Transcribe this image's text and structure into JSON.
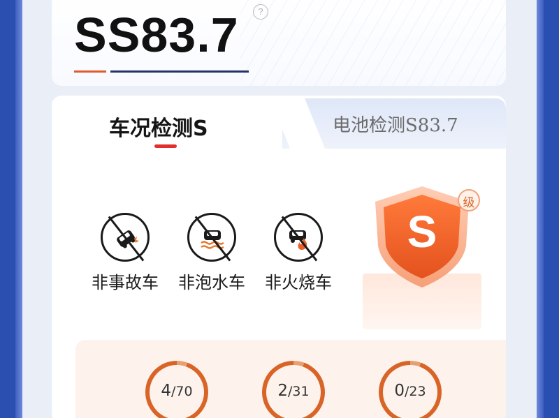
{
  "score": {
    "value": "SS83.7",
    "help_icon": "question-circle-icon",
    "help_symbol": "?"
  },
  "tabs": [
    {
      "label": "车况检测S",
      "active": true
    },
    {
      "label": "电池检测S83.7",
      "active": false
    }
  ],
  "badges": [
    {
      "label": "非事故车",
      "icon": "no-accident-icon"
    },
    {
      "label": "非泡水车",
      "icon": "no-flood-icon"
    },
    {
      "label": "非火烧车",
      "icon": "no-fire-icon"
    }
  ],
  "grade": {
    "letter": "S",
    "suffix": "级"
  },
  "stats": [
    {
      "count": "4",
      "total": "/70"
    },
    {
      "count": "2",
      "total": "/31"
    },
    {
      "count": "0",
      "total": "/23"
    }
  ],
  "colors": {
    "accent_red": "#e0302c",
    "accent_orange": "#d96428",
    "frame_blue": "#2b4fb0"
  }
}
